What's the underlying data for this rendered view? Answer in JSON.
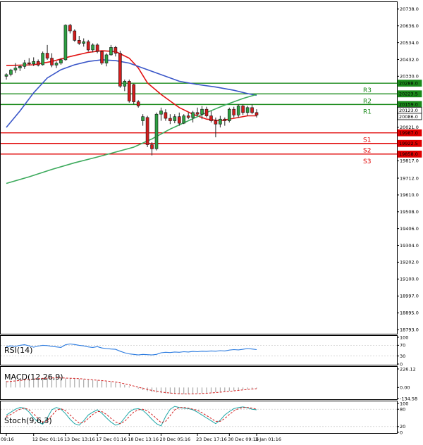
{
  "chart_data": {
    "type": "candlestick",
    "price_axis": {
      "ticks": [
        "20738.0",
        "20636.0",
        "20534.0",
        "20432.0",
        "20330.0",
        "20021.0",
        "19919.0",
        "19817.0",
        "19712.0",
        "19610.0",
        "19508.0",
        "19406.0",
        "19304.0",
        "19202.0",
        "19100.0",
        "18997.0",
        "18895.0",
        "18793.0"
      ],
      "tick_values": [
        20738,
        20636,
        20534,
        20432,
        20330,
        20021,
        19919,
        19817,
        19712,
        19610,
        19508,
        19406,
        19304,
        19202,
        19100,
        18997,
        18895,
        18793
      ],
      "range": [
        18768,
        20780
      ]
    },
    "time_axis": {
      "labels": [
        "09:16",
        "12 Dec 01:16",
        "13 Dec 13:16",
        "17 Dec 01:16",
        "18 Dec 13:16",
        "20 Dec 05:16",
        "23 Dec 17:16",
        "30 Dec 09:16",
        "3 Jan 01:16"
      ],
      "label_index": [
        0,
        6,
        13,
        20,
        27,
        34,
        42,
        49,
        55
      ]
    },
    "candles": [
      {
        "o": 20330,
        "h": 20348,
        "l": 20310,
        "c": 20340
      },
      {
        "o": 20342,
        "h": 20375,
        "l": 20330,
        "c": 20368
      },
      {
        "o": 20368,
        "h": 20410,
        "l": 20350,
        "c": 20380
      },
      {
        "o": 20380,
        "h": 20400,
        "l": 20362,
        "c": 20390
      },
      {
        "o": 20390,
        "h": 20430,
        "l": 20375,
        "c": 20412
      },
      {
        "o": 20412,
        "h": 20440,
        "l": 20395,
        "c": 20405
      },
      {
        "o": 20405,
        "h": 20445,
        "l": 20392,
        "c": 20420
      },
      {
        "o": 20420,
        "h": 20432,
        "l": 20390,
        "c": 20398
      },
      {
        "o": 20400,
        "h": 20480,
        "l": 20395,
        "c": 20470
      },
      {
        "o": 20470,
        "h": 20520,
        "l": 20430,
        "c": 20440
      },
      {
        "o": 20440,
        "h": 20470,
        "l": 20385,
        "c": 20398
      },
      {
        "o": 20398,
        "h": 20420,
        "l": 20380,
        "c": 20410
      },
      {
        "o": 20410,
        "h": 20440,
        "l": 20400,
        "c": 20430
      },
      {
        "o": 20430,
        "h": 20645,
        "l": 20425,
        "c": 20640
      },
      {
        "o": 20640,
        "h": 20648,
        "l": 20590,
        "c": 20605
      },
      {
        "o": 20605,
        "h": 20615,
        "l": 20540,
        "c": 20548
      },
      {
        "o": 20548,
        "h": 20575,
        "l": 20520,
        "c": 20530
      },
      {
        "o": 20530,
        "h": 20560,
        "l": 20510,
        "c": 20540
      },
      {
        "o": 20540,
        "h": 20550,
        "l": 20480,
        "c": 20490
      },
      {
        "o": 20490,
        "h": 20530,
        "l": 20475,
        "c": 20520
      },
      {
        "o": 20520,
        "h": 20530,
        "l": 20470,
        "c": 20480
      },
      {
        "o": 20480,
        "h": 20485,
        "l": 20400,
        "c": 20410
      },
      {
        "o": 20410,
        "h": 20470,
        "l": 20390,
        "c": 20460
      },
      {
        "o": 20460,
        "h": 20520,
        "l": 20455,
        "c": 20505
      },
      {
        "o": 20505,
        "h": 20515,
        "l": 20450,
        "c": 20470
      },
      {
        "o": 20470,
        "h": 20485,
        "l": 20260,
        "c": 20270
      },
      {
        "o": 20270,
        "h": 20310,
        "l": 20240,
        "c": 20300
      },
      {
        "o": 20300,
        "h": 20310,
        "l": 20170,
        "c": 20180
      },
      {
        "o": 20280,
        "h": 20285,
        "l": 20160,
        "c": 20175
      },
      {
        "o": 20175,
        "h": 20185,
        "l": 20140,
        "c": 20150
      },
      {
        "o": 20060,
        "h": 20100,
        "l": 20030,
        "c": 20085
      },
      {
        "o": 20080,
        "h": 20090,
        "l": 19900,
        "c": 19915
      },
      {
        "o": 19915,
        "h": 19930,
        "l": 19850,
        "c": 19890
      },
      {
        "o": 19890,
        "h": 20110,
        "l": 19880,
        "c": 20100
      },
      {
        "o": 20100,
        "h": 20140,
        "l": 20060,
        "c": 20120
      },
      {
        "o": 20110,
        "h": 20130,
        "l": 20060,
        "c": 20075
      },
      {
        "o": 20075,
        "h": 20100,
        "l": 20040,
        "c": 20060
      },
      {
        "o": 20060,
        "h": 20100,
        "l": 20045,
        "c": 20085
      },
      {
        "o": 20085,
        "h": 20110,
        "l": 20030,
        "c": 20045
      },
      {
        "o": 20045,
        "h": 20100,
        "l": 20040,
        "c": 20090
      },
      {
        "o": 20090,
        "h": 20110,
        "l": 20070,
        "c": 20080
      },
      {
        "o": 20080,
        "h": 20120,
        "l": 20050,
        "c": 20110
      },
      {
        "o": 20110,
        "h": 20140,
        "l": 20090,
        "c": 20100
      },
      {
        "o": 20100,
        "h": 20150,
        "l": 20070,
        "c": 20130
      },
      {
        "o": 20130,
        "h": 20145,
        "l": 20080,
        "c": 20090
      },
      {
        "o": 20090,
        "h": 20120,
        "l": 20050,
        "c": 20060
      },
      {
        "o": 20060,
        "h": 20080,
        "l": 19960,
        "c": 20040
      },
      {
        "o": 20040,
        "h": 20090,
        "l": 20020,
        "c": 20070
      },
      {
        "o": 20070,
        "h": 20080,
        "l": 20030,
        "c": 20060
      },
      {
        "o": 20060,
        "h": 20140,
        "l": 20050,
        "c": 20130
      },
      {
        "o": 20130,
        "h": 20145,
        "l": 20080,
        "c": 20095
      },
      {
        "o": 20095,
        "h": 20160,
        "l": 20080,
        "c": 20150
      },
      {
        "o": 20150,
        "h": 20160,
        "l": 20095,
        "c": 20110
      },
      {
        "o": 20110,
        "h": 20150,
        "l": 20090,
        "c": 20140
      },
      {
        "o": 20140,
        "h": 20160,
        "l": 20100,
        "c": 20110
      },
      {
        "o": 20110,
        "h": 20130,
        "l": 20080,
        "c": 20095
      }
    ],
    "moving_averages": [
      {
        "color": "#e21212",
        "points": [
          [
            0,
            20395
          ],
          [
            6,
            20400
          ],
          [
            10,
            20420
          ],
          [
            14,
            20450
          ],
          [
            18,
            20475
          ],
          [
            21,
            20485
          ],
          [
            24,
            20480
          ],
          [
            27,
            20440
          ],
          [
            29,
            20380
          ],
          [
            31,
            20290
          ],
          [
            34,
            20220
          ],
          [
            36,
            20180
          ],
          [
            38,
            20140
          ],
          [
            41,
            20100
          ],
          [
            44,
            20070
          ],
          [
            47,
            20060
          ],
          [
            50,
            20075
          ],
          [
            53,
            20090
          ],
          [
            55,
            20090
          ]
        ]
      },
      {
        "color": "#3a56c8",
        "points": [
          [
            0,
            20020
          ],
          [
            3,
            20120
          ],
          [
            6,
            20230
          ],
          [
            9,
            20320
          ],
          [
            12,
            20370
          ],
          [
            15,
            20400
          ],
          [
            18,
            20420
          ],
          [
            21,
            20430
          ],
          [
            24,
            20425
          ],
          [
            27,
            20410
          ],
          [
            30,
            20380
          ],
          [
            34,
            20340
          ],
          [
            38,
            20300
          ],
          [
            42,
            20280
          ],
          [
            46,
            20265
          ],
          [
            50,
            20245
          ],
          [
            53,
            20225
          ],
          [
            55,
            20215
          ]
        ]
      },
      {
        "color": "#3caa5c",
        "points": [
          [
            0,
            19680
          ],
          [
            5,
            19720
          ],
          [
            10,
            19765
          ],
          [
            15,
            19805
          ],
          [
            20,
            19840
          ],
          [
            24,
            19870
          ],
          [
            28,
            19900
          ],
          [
            32,
            19950
          ],
          [
            36,
            20010
          ],
          [
            40,
            20060
          ],
          [
            44,
            20110
          ],
          [
            48,
            20155
          ],
          [
            52,
            20195
          ],
          [
            55,
            20220
          ]
        ]
      }
    ],
    "levels": [
      {
        "label": "R3",
        "value": 20288.0,
        "tag": "20288.0",
        "color": "#1a8a1a"
      },
      {
        "label": "R2",
        "value": 20223.5,
        "tag": "20223.5",
        "color": "#1a8a1a"
      },
      {
        "label": "R1",
        "value": 20159.0,
        "tag": "20159.0",
        "color": "#1a8a1a"
      },
      {
        "label": "S1",
        "value": 19987.0,
        "tag": "19987.0",
        "color": "#e00000"
      },
      {
        "label": "S2",
        "value": 19922.5,
        "tag": "19922.5",
        "color": "#e00000"
      },
      {
        "label": "S3",
        "value": 19858.0,
        "tag": "19858.0",
        "color": "#e00000"
      }
    ],
    "current_price": {
      "value": 20086.0,
      "tag": "20086.0"
    },
    "extra_tag": {
      "value": 20123.0,
      "tag": "20123.0"
    },
    "rsi": {
      "title": "RSI(14)",
      "ticks": [
        "100",
        "70",
        "30",
        "0"
      ],
      "tick_values": [
        100,
        70,
        30,
        0
      ],
      "color": "#2b7be0",
      "values": [
        65,
        68,
        66,
        70,
        72,
        68,
        63,
        67,
        70,
        69,
        66,
        64,
        62,
        72,
        75,
        73,
        70,
        68,
        64,
        62,
        65,
        60,
        58,
        56,
        55,
        48,
        42,
        38,
        36,
        34,
        36,
        35,
        34,
        36,
        42,
        44,
        43,
        45,
        44,
        46,
        45,
        47,
        46,
        48,
        47,
        49,
        48,
        50,
        49,
        52,
        54,
        53,
        55,
        58,
        56,
        54
      ]
    },
    "macd": {
      "title": "MACD(12,26,9)",
      "ticks": [
        "226.12",
        "0.00",
        "-134.58"
      ],
      "tick_values": [
        226.12,
        0,
        -134.58
      ],
      "hist": [
        80,
        85,
        90,
        95,
        100,
        105,
        110,
        112,
        115,
        118,
        120,
        118,
        115,
        112,
        110,
        108,
        105,
        100,
        95,
        90,
        85,
        80,
        75,
        70,
        60,
        45,
        30,
        15,
        0,
        -15,
        -30,
        -45,
        -55,
        -62,
        -68,
        -72,
        -75,
        -78,
        -80,
        -80,
        -78,
        -76,
        -73,
        -70,
        -66,
        -62,
        -57,
        -52,
        -47,
        -42,
        -36,
        -30,
        -25,
        -20,
        -15,
        -12
      ],
      "signal": [
        70,
        75,
        80,
        86,
        92,
        98,
        103,
        107,
        111,
        114,
        117,
        118,
        117,
        115,
        113,
        111,
        108,
        104,
        99,
        94,
        89,
        84,
        79,
        74,
        67,
        57,
        45,
        32,
        18,
        4,
        -10,
        -24,
        -36,
        -46,
        -55,
        -62,
        -68,
        -72,
        -76,
        -78,
        -79,
        -78,
        -76,
        -73,
        -70,
        -66,
        -62,
        -57,
        -52,
        -47,
        -41,
        -35,
        -29,
        -24,
        -19,
        -14
      ]
    },
    "stoch": {
      "title": "Stoch(9,6,3)",
      "ticks": [
        "100",
        "80",
        "20",
        "0"
      ],
      "tick_values": [
        100,
        80,
        20,
        0
      ],
      "main": [
        60,
        70,
        80,
        86,
        84,
        70,
        50,
        35,
        28,
        50,
        78,
        86,
        80,
        65,
        45,
        30,
        25,
        40,
        60,
        70,
        78,
        66,
        50,
        35,
        25,
        30,
        50,
        70,
        80,
        82,
        76,
        62,
        45,
        30,
        22,
        55,
        80,
        90,
        86,
        84,
        82,
        78,
        70,
        60,
        50,
        40,
        30,
        42,
        60,
        72,
        82,
        86,
        88,
        85,
        80,
        78
      ],
      "signal": [
        55,
        62,
        72,
        80,
        84,
        78,
        64,
        48,
        36,
        40,
        58,
        76,
        82,
        75,
        60,
        45,
        32,
        34,
        48,
        62,
        72,
        72,
        62,
        48,
        36,
        30,
        38,
        55,
        70,
        78,
        80,
        74,
        62,
        48,
        34,
        38,
        58,
        78,
        86,
        86,
        84,
        80,
        76,
        68,
        58,
        48,
        38,
        38,
        48,
        62,
        74,
        82,
        86,
        86,
        84,
        80
      ]
    }
  }
}
